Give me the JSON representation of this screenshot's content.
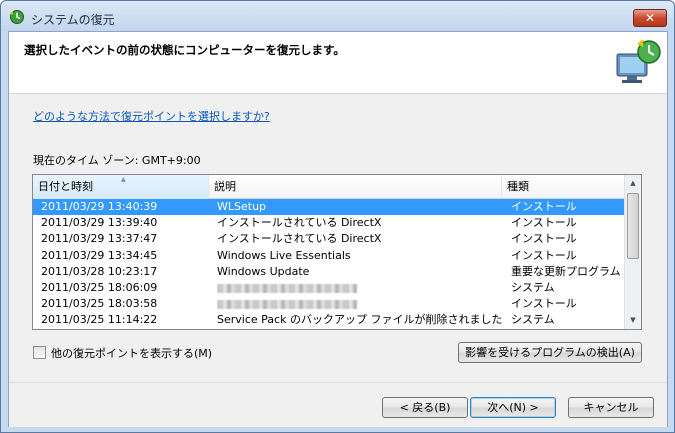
{
  "window": {
    "title": "システムの復元",
    "close_label": "✕"
  },
  "header": {
    "instruction": "選択したイベントの前の状態にコンピューターを復元します。"
  },
  "help_link": "どのような方法で復元ポイントを選択しますか?",
  "timezone_label": "現在のタイム ゾーン: GMT+9:00",
  "table": {
    "columns": [
      "日付と時刻",
      "説明",
      "種類"
    ],
    "rows": [
      {
        "date": "2011/03/29 13:40:39",
        "desc": "WLSetup",
        "type": "インストール",
        "selected": true
      },
      {
        "date": "2011/03/29 13:39:40",
        "desc": "インストールされている DirectX",
        "type": "インストール"
      },
      {
        "date": "2011/03/29 13:37:47",
        "desc": "インストールされている DirectX",
        "type": "インストール"
      },
      {
        "date": "2011/03/29 13:34:45",
        "desc": "Windows Live Essentials",
        "type": "インストール"
      },
      {
        "date": "2011/03/28 10:23:17",
        "desc": "Windows Update",
        "type": "重要な更新プログラム"
      },
      {
        "date": "2011/03/25 18:06:09",
        "desc": "",
        "type": "システム",
        "redacted": true
      },
      {
        "date": "2011/03/25 18:03:58",
        "desc": "",
        "type": "インストール",
        "redacted": true
      },
      {
        "date": "2011/03/25 11:14:22",
        "desc": "Service Pack のバックアップ ファイルが削除されました",
        "type": "システム"
      }
    ]
  },
  "show_more_checkbox": {
    "label": "他の復元ポイントを表示する(M)",
    "checked": false
  },
  "buttons": {
    "scan": "影響を受けるプログラムの検出(A)",
    "back": "< 戻る(B)",
    "next": "次へ(N) >",
    "cancel": "キャンセル"
  },
  "colors": {
    "selection": "#3399ff",
    "link": "#0a55b5"
  },
  "icons": {
    "title": "system-restore-icon",
    "header": "system-restore-graphic"
  }
}
